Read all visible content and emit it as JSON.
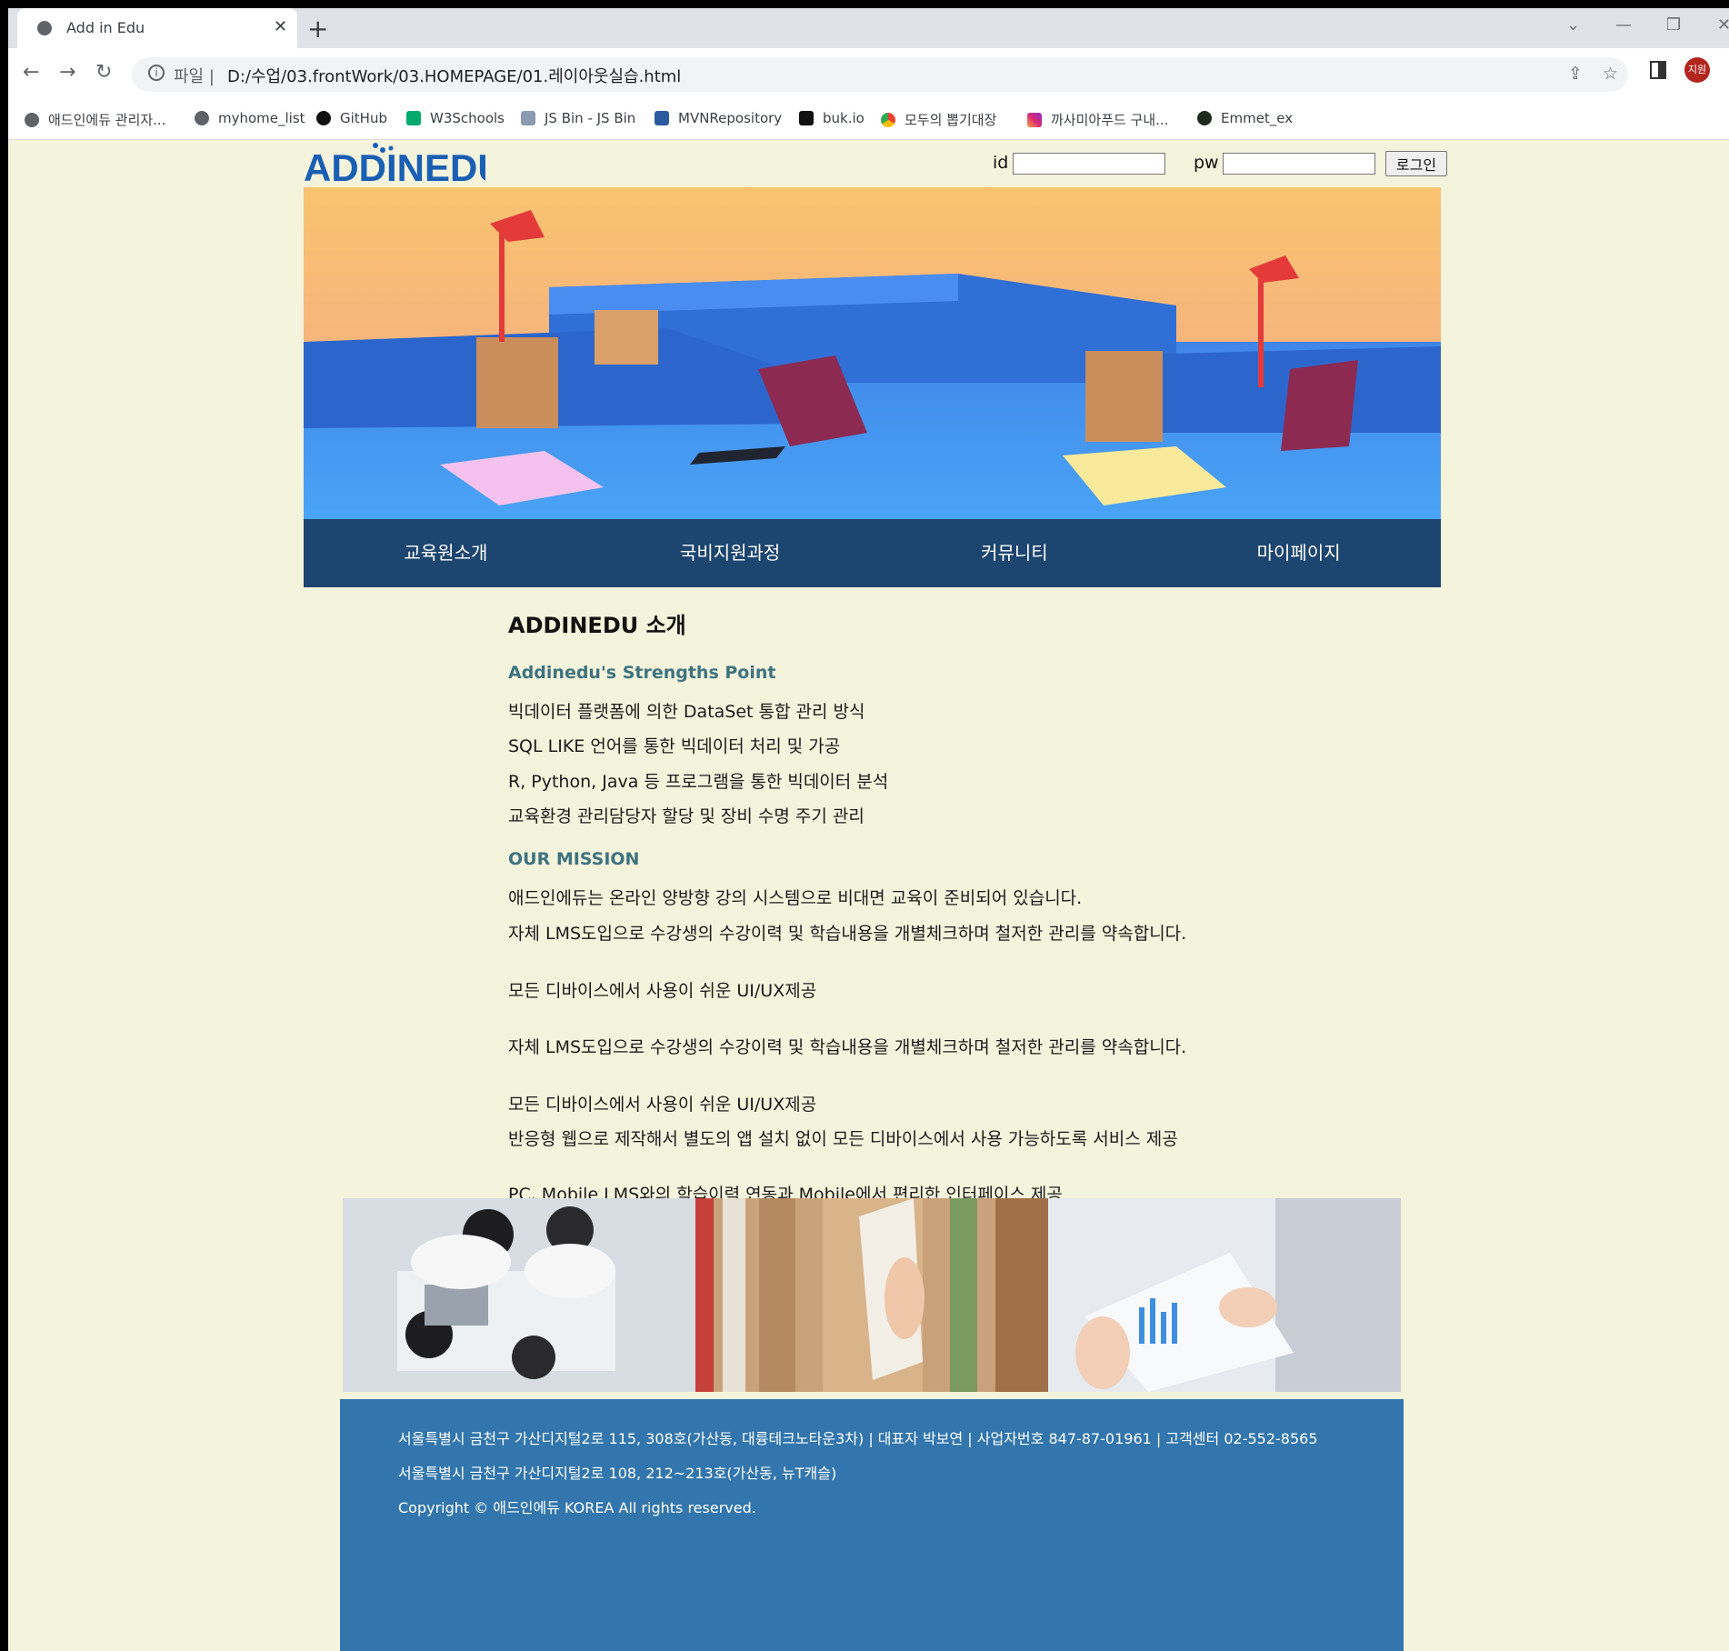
{
  "browser": {
    "tab_title": "Add in Edu",
    "url_scheme": "파일",
    "url": "D:/수업/03.frontWork/03.HOMEPAGE/01.레이아웃실습.html",
    "profile_initials": "지원",
    "bookmarks": [
      {
        "label": "애드인에듀 관리자...",
        "icon": "globe-icon"
      },
      {
        "label": "myhome_list",
        "icon": "globe-icon"
      },
      {
        "label": "GitHub",
        "icon": "github-icon"
      },
      {
        "label": "W3Schools",
        "icon": "w3schools-icon"
      },
      {
        "label": "JS Bin - JS Bin",
        "icon": "jsbin-icon"
      },
      {
        "label": "MVNRepository",
        "icon": "mvn-icon"
      },
      {
        "label": "buk.io",
        "icon": "bukio-icon"
      },
      {
        "label": "모두의 뽑기대장",
        "icon": "chrome-icon"
      },
      {
        "label": "까사미아푸드 구내...",
        "icon": "instagram-icon"
      },
      {
        "label": "Emmet_ex",
        "icon": "emmet-icon"
      }
    ]
  },
  "header": {
    "logo_text": "ADDINEDU",
    "id_label": "id",
    "pw_label": "pw",
    "login_button": "로그인"
  },
  "nav": {
    "items": [
      "교육원소개",
      "국비지원과정",
      "커뮤니티",
      "마이페이지"
    ]
  },
  "content": {
    "title": "ADDINEDU 소개",
    "strengths_heading": "Addinedu's Strengths Point",
    "strengths": [
      "빅데이터 플랫폼에 의한 DataSet 통합 관리 방식",
      "SQL LIKE 언어를 통한 빅데이터 처리 및 가공",
      "R, Python, Java 등 프로그램을 통한 빅데이터 분석",
      "교육환경 관리담당자 할당 및 장비 수명 주기 관리"
    ],
    "mission_heading": "OUR MISSION",
    "mission": [
      "애드인에듀는 온라인 양방향 강의 시스템으로 비대면 교육이 준비되어 있습니다.",
      "자체 LMS도입으로 수강생의 수강이력 및 학습내용을 개별체크하며 철저한 관리를 약속합니다.",
      "모든 디바이스에서 사용이 쉬운 UI/UX제공",
      "자체 LMS도입으로 수강생의 수강이력 및 학습내용을 개별체크하며 철저한 관리를 약속합니다.",
      "모든 디바이스에서 사용이 쉬운 UI/UX제공",
      "반응형 웹으로 제작해서 별도의 앱 설치 없이 모든 디바이스에서 사용 가능하도록 서비스 제공",
      "PC, Mobile LMS와의 학습이력 연동과 Mobile에서 편리한 인터페이스 제공"
    ]
  },
  "footer": {
    "address1": "서울특별시 금천구 가산디지털2로 115, 308호(가산동, 대륭테크노타운3차) | 대표자 박보연 | 사업자번호 847-87-01961 | 고객센터 02-552-8565",
    "address2": "서울특별시 금천구 가산디지털2로 108, 212~213호(가산동, 뉴T캐슬)",
    "copyright": "Copyright © 애드인에듀 KOREA All rights reserved."
  },
  "colors": {
    "page_bg": "#f4f3dc",
    "nav_bg": "#1c456f",
    "subheading": "#3e7380",
    "footer_bg": "#3276ad"
  }
}
